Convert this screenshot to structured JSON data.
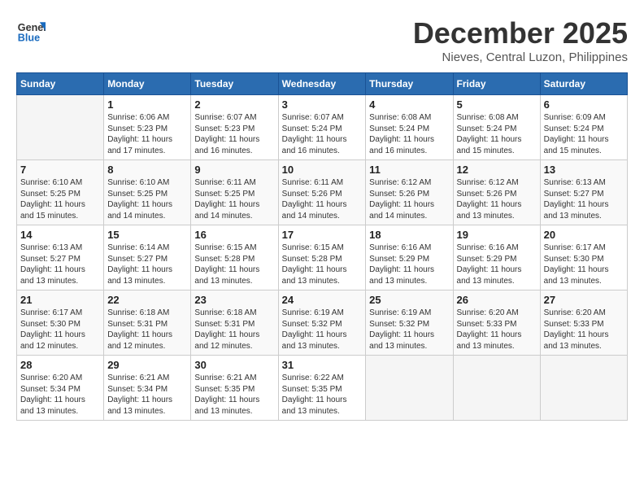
{
  "header": {
    "logo_line1": "General",
    "logo_line2": "Blue",
    "month_title": "December 2025",
    "subtitle": "Nieves, Central Luzon, Philippines"
  },
  "weekdays": [
    "Sunday",
    "Monday",
    "Tuesday",
    "Wednesday",
    "Thursday",
    "Friday",
    "Saturday"
  ],
  "weeks": [
    [
      {
        "day": "",
        "sunrise": "",
        "sunset": "",
        "daylight": ""
      },
      {
        "day": "1",
        "sunrise": "Sunrise: 6:06 AM",
        "sunset": "Sunset: 5:23 PM",
        "daylight": "Daylight: 11 hours and 17 minutes."
      },
      {
        "day": "2",
        "sunrise": "Sunrise: 6:07 AM",
        "sunset": "Sunset: 5:23 PM",
        "daylight": "Daylight: 11 hours and 16 minutes."
      },
      {
        "day": "3",
        "sunrise": "Sunrise: 6:07 AM",
        "sunset": "Sunset: 5:24 PM",
        "daylight": "Daylight: 11 hours and 16 minutes."
      },
      {
        "day": "4",
        "sunrise": "Sunrise: 6:08 AM",
        "sunset": "Sunset: 5:24 PM",
        "daylight": "Daylight: 11 hours and 16 minutes."
      },
      {
        "day": "5",
        "sunrise": "Sunrise: 6:08 AM",
        "sunset": "Sunset: 5:24 PM",
        "daylight": "Daylight: 11 hours and 15 minutes."
      },
      {
        "day": "6",
        "sunrise": "Sunrise: 6:09 AM",
        "sunset": "Sunset: 5:24 PM",
        "daylight": "Daylight: 11 hours and 15 minutes."
      }
    ],
    [
      {
        "day": "7",
        "sunrise": "Sunrise: 6:10 AM",
        "sunset": "Sunset: 5:25 PM",
        "daylight": "Daylight: 11 hours and 15 minutes."
      },
      {
        "day": "8",
        "sunrise": "Sunrise: 6:10 AM",
        "sunset": "Sunset: 5:25 PM",
        "daylight": "Daylight: 11 hours and 14 minutes."
      },
      {
        "day": "9",
        "sunrise": "Sunrise: 6:11 AM",
        "sunset": "Sunset: 5:25 PM",
        "daylight": "Daylight: 11 hours and 14 minutes."
      },
      {
        "day": "10",
        "sunrise": "Sunrise: 6:11 AM",
        "sunset": "Sunset: 5:26 PM",
        "daylight": "Daylight: 11 hours and 14 minutes."
      },
      {
        "day": "11",
        "sunrise": "Sunrise: 6:12 AM",
        "sunset": "Sunset: 5:26 PM",
        "daylight": "Daylight: 11 hours and 14 minutes."
      },
      {
        "day": "12",
        "sunrise": "Sunrise: 6:12 AM",
        "sunset": "Sunset: 5:26 PM",
        "daylight": "Daylight: 11 hours and 13 minutes."
      },
      {
        "day": "13",
        "sunrise": "Sunrise: 6:13 AM",
        "sunset": "Sunset: 5:27 PM",
        "daylight": "Daylight: 11 hours and 13 minutes."
      }
    ],
    [
      {
        "day": "14",
        "sunrise": "Sunrise: 6:13 AM",
        "sunset": "Sunset: 5:27 PM",
        "daylight": "Daylight: 11 hours and 13 minutes."
      },
      {
        "day": "15",
        "sunrise": "Sunrise: 6:14 AM",
        "sunset": "Sunset: 5:27 PM",
        "daylight": "Daylight: 11 hours and 13 minutes."
      },
      {
        "day": "16",
        "sunrise": "Sunrise: 6:15 AM",
        "sunset": "Sunset: 5:28 PM",
        "daylight": "Daylight: 11 hours and 13 minutes."
      },
      {
        "day": "17",
        "sunrise": "Sunrise: 6:15 AM",
        "sunset": "Sunset: 5:28 PM",
        "daylight": "Daylight: 11 hours and 13 minutes."
      },
      {
        "day": "18",
        "sunrise": "Sunrise: 6:16 AM",
        "sunset": "Sunset: 5:29 PM",
        "daylight": "Daylight: 11 hours and 13 minutes."
      },
      {
        "day": "19",
        "sunrise": "Sunrise: 6:16 AM",
        "sunset": "Sunset: 5:29 PM",
        "daylight": "Daylight: 11 hours and 13 minutes."
      },
      {
        "day": "20",
        "sunrise": "Sunrise: 6:17 AM",
        "sunset": "Sunset: 5:30 PM",
        "daylight": "Daylight: 11 hours and 13 minutes."
      }
    ],
    [
      {
        "day": "21",
        "sunrise": "Sunrise: 6:17 AM",
        "sunset": "Sunset: 5:30 PM",
        "daylight": "Daylight: 11 hours and 12 minutes."
      },
      {
        "day": "22",
        "sunrise": "Sunrise: 6:18 AM",
        "sunset": "Sunset: 5:31 PM",
        "daylight": "Daylight: 11 hours and 12 minutes."
      },
      {
        "day": "23",
        "sunrise": "Sunrise: 6:18 AM",
        "sunset": "Sunset: 5:31 PM",
        "daylight": "Daylight: 11 hours and 12 minutes."
      },
      {
        "day": "24",
        "sunrise": "Sunrise: 6:19 AM",
        "sunset": "Sunset: 5:32 PM",
        "daylight": "Daylight: 11 hours and 13 minutes."
      },
      {
        "day": "25",
        "sunrise": "Sunrise: 6:19 AM",
        "sunset": "Sunset: 5:32 PM",
        "daylight": "Daylight: 11 hours and 13 minutes."
      },
      {
        "day": "26",
        "sunrise": "Sunrise: 6:20 AM",
        "sunset": "Sunset: 5:33 PM",
        "daylight": "Daylight: 11 hours and 13 minutes."
      },
      {
        "day": "27",
        "sunrise": "Sunrise: 6:20 AM",
        "sunset": "Sunset: 5:33 PM",
        "daylight": "Daylight: 11 hours and 13 minutes."
      }
    ],
    [
      {
        "day": "28",
        "sunrise": "Sunrise: 6:20 AM",
        "sunset": "Sunset: 5:34 PM",
        "daylight": "Daylight: 11 hours and 13 minutes."
      },
      {
        "day": "29",
        "sunrise": "Sunrise: 6:21 AM",
        "sunset": "Sunset: 5:34 PM",
        "daylight": "Daylight: 11 hours and 13 minutes."
      },
      {
        "day": "30",
        "sunrise": "Sunrise: 6:21 AM",
        "sunset": "Sunset: 5:35 PM",
        "daylight": "Daylight: 11 hours and 13 minutes."
      },
      {
        "day": "31",
        "sunrise": "Sunrise: 6:22 AM",
        "sunset": "Sunset: 5:35 PM",
        "daylight": "Daylight: 11 hours and 13 minutes."
      },
      {
        "day": "",
        "sunrise": "",
        "sunset": "",
        "daylight": ""
      },
      {
        "day": "",
        "sunrise": "",
        "sunset": "",
        "daylight": ""
      },
      {
        "day": "",
        "sunrise": "",
        "sunset": "",
        "daylight": ""
      }
    ]
  ]
}
